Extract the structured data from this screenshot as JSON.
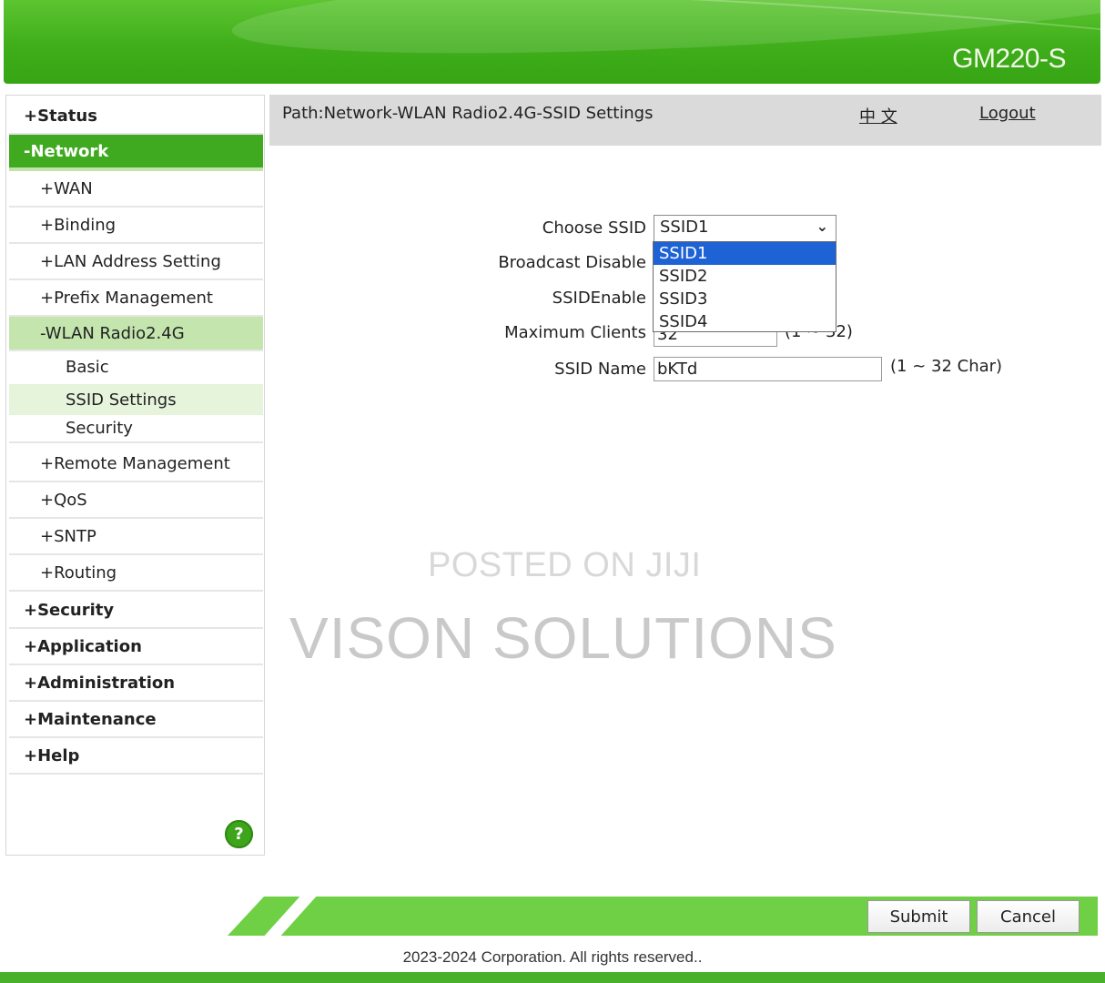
{
  "header": {
    "model": "GM220-S"
  },
  "sidebar": {
    "items": [
      {
        "label": "+Status"
      },
      {
        "label": "-Network"
      },
      {
        "label": "+WAN"
      },
      {
        "label": "+Binding"
      },
      {
        "label": "+LAN Address Setting"
      },
      {
        "label": "+Prefix Management"
      },
      {
        "label": "-WLAN Radio2.4G"
      },
      {
        "label": "Basic"
      },
      {
        "label": "SSID Settings"
      },
      {
        "label": "Security"
      },
      {
        "label": "+Remote Management"
      },
      {
        "label": "+QoS"
      },
      {
        "label": "+SNTP"
      },
      {
        "label": "+Routing"
      },
      {
        "label": "+Security"
      },
      {
        "label": "+Application"
      },
      {
        "label": "+Administration"
      },
      {
        "label": "+Maintenance"
      },
      {
        "label": "+Help"
      }
    ],
    "help_icon": "?"
  },
  "pathbar": {
    "path": "Path:Network-WLAN Radio2.4G-SSID Settings",
    "language_link": "中 文",
    "logout_link": "Logout"
  },
  "form": {
    "choose_ssid_label": "Choose SSID",
    "choose_ssid_value": "SSID1",
    "broadcast_disable_label": "Broadcast Disable",
    "ssid_enable_label": "SSIDEnable",
    "max_clients_label": "Maximum Clients",
    "max_clients_value": "32",
    "max_clients_hint": "(1 ~ 32)",
    "ssid_name_label": "SSID Name",
    "ssid_name_value": "bKTd",
    "ssid_name_hint": "(1 ~ 32 Char)",
    "dropdown_options": [
      "SSID1",
      "SSID2",
      "SSID3",
      "SSID4"
    ]
  },
  "watermark": {
    "line1": "POSTED ON JIJI",
    "line2": "VISON SOLUTIONS"
  },
  "footer": {
    "submit_label": "Submit",
    "cancel_label": "Cancel",
    "copyright": "2023-2024 Corporation. All rights reserved.."
  },
  "colors": {
    "brand_green": "#3faa1f",
    "selected_option_blue": "#1e63d6"
  }
}
